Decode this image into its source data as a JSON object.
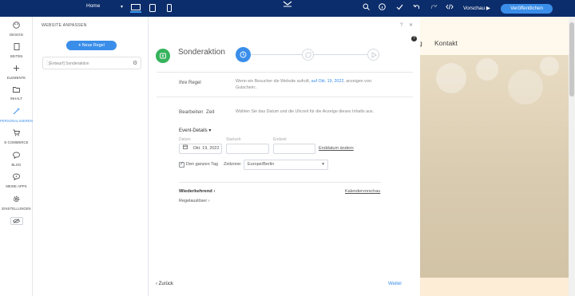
{
  "topbar": {
    "page_selector": "Home",
    "preview_label": "Vorschau",
    "publish_label": "Veröffentlichen"
  },
  "sidebar": {
    "items": [
      {
        "label": "DESIGN",
        "icon": "palette-icon"
      },
      {
        "label": "SEITEN",
        "icon": "page-icon"
      },
      {
        "label": "ELEMENTE",
        "icon": "plus-icon"
      },
      {
        "label": "INHALT",
        "icon": "folder-icon"
      },
      {
        "label": "PERSONALISIEREN",
        "icon": "wand-icon"
      },
      {
        "label": "E-COMMERCE",
        "icon": "cart-icon"
      },
      {
        "label": "BLOG",
        "icon": "chat-icon"
      },
      {
        "label": "MEINE APPS",
        "icon": "apps-icon"
      },
      {
        "label": "EINSTELLUNGEN",
        "icon": "gear-icon"
      }
    ],
    "active": "PERSONALISIEREN"
  },
  "panel": {
    "title": "WEBSITE ANPASSEN",
    "add_rule_label": "Neue Regel",
    "rules": [
      {
        "label": "[Entwurf] Sonderaktion"
      }
    ]
  },
  "editor": {
    "title": "Sonderaktion",
    "rule_section_label": "Ihre Regel",
    "rule_desc_pre": "Wenn ein Besucher die Website aufruft,",
    "rule_desc_link": "auf Okt. 19, 2022",
    "rule_desc_post": ", anzeigen von:",
    "rule_desc_line2": "Gutschein:.",
    "edit_label": "Bearbeiten",
    "time_label": "Zeit",
    "time_desc": "Wählen Sie das Datum und die Uhrzeit für die Anzeige dieses Inhalts aus.",
    "event_details_label": "Event-Details",
    "date_label": "Datum",
    "date_value": "Okt. 19, 2022",
    "start_time_label": "Startzeit",
    "end_time_label": "Endzeit",
    "change_end_date_label": "Enddatum ändern",
    "all_day_label": "Den ganzen Tag",
    "all_day_checked": true,
    "timezone_label": "Zeitzone:",
    "timezone_value": "Europe/Berlin",
    "recurring_label": "Wiederkehrend",
    "calendar_preview_label": "Kalendervorschau",
    "trigger_label": "Regelauslöser",
    "back_label": "Zurück",
    "next_label": "Weiter"
  },
  "preview": {
    "nav_items": [
      "g",
      "Kontakt"
    ]
  },
  "colors": {
    "topbar": "#0c2d6b",
    "accent": "#3a8eea",
    "success": "#35b35c"
  }
}
